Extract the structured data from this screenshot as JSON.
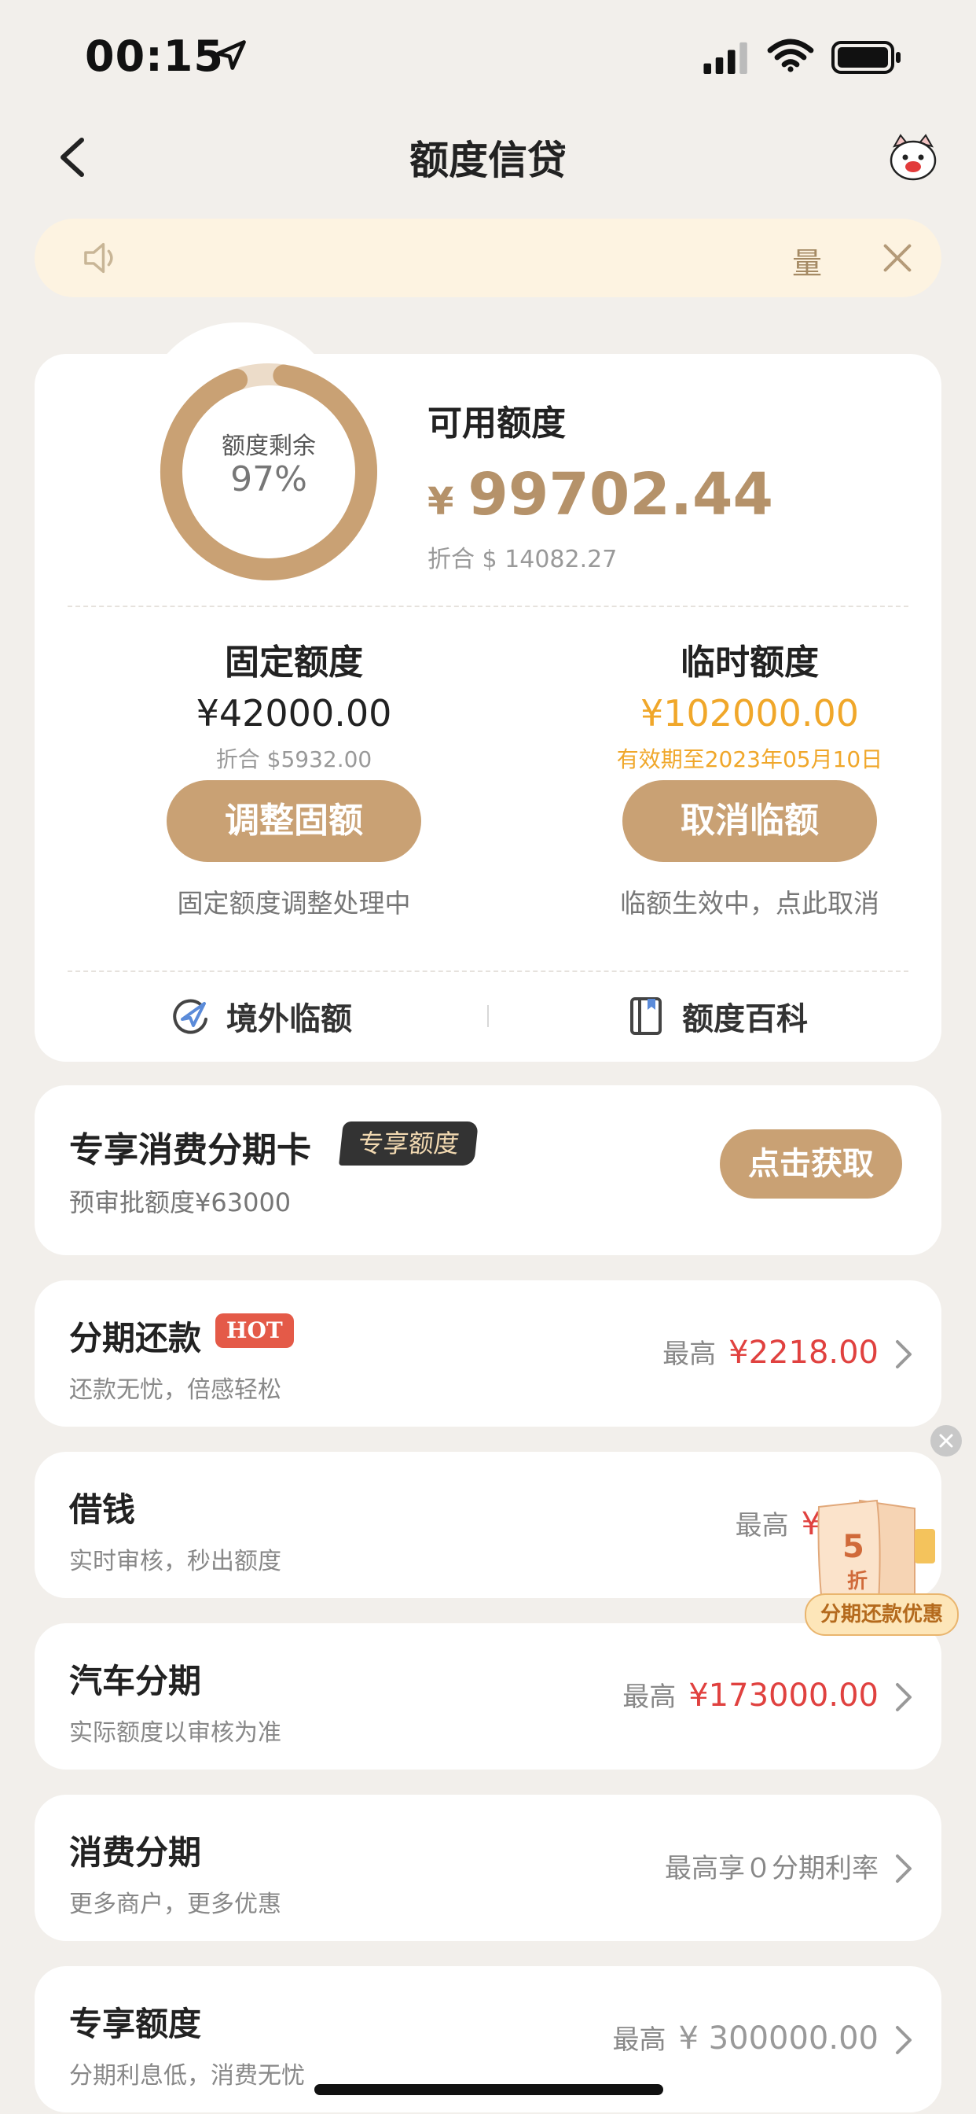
{
  "status_bar": {
    "time": "00:15"
  },
  "nav": {
    "title": "额度信贷"
  },
  "notice": {
    "text": "量"
  },
  "credit": {
    "ring_label": "额度剩余",
    "ring_percent": "97%",
    "ring_fraction": 0.97,
    "available_title": "可用额度",
    "available_currency": "¥",
    "available_amount": "99702.44",
    "available_usd": "折合 $ 14082.27",
    "fixed": {
      "title": "固定额度",
      "amount": "¥42000.00",
      "sub": "折合 $5932.00",
      "button": "调整固额",
      "note": "固定额度调整处理中"
    },
    "temp": {
      "title": "临时额度",
      "amount": "¥102000.00",
      "sub": "有效期至2023年05月10日",
      "button": "取消临额",
      "note": "临额生效中，点此取消"
    },
    "links": {
      "overseas": "境外临额",
      "wiki": "额度百科"
    }
  },
  "exclusive": {
    "title": "专享消费分期卡",
    "badge": "专享额度",
    "sub": "预审批额度¥63000",
    "button": "点击获取"
  },
  "list": [
    {
      "title": "分期还款",
      "tag": "HOT",
      "sub": "还款无忧，倍感轻松",
      "prefix": "最高",
      "amount": "¥2218.00"
    },
    {
      "title": "借钱",
      "sub": "实时审核，秒出额度",
      "prefix": "最高",
      "amount": "¥42"
    },
    {
      "title": "汽车分期",
      "sub": "实际额度以审核为准",
      "prefix": "最高",
      "amount": "¥173000.00"
    },
    {
      "title": "消费分期",
      "sub": "更多商户，更多优惠",
      "text": "最高享０分期利率"
    },
    {
      "title": "专享额度",
      "sub": "分期利息低，消费无忧",
      "prefix": "最高",
      "amount": "¥ 300000.00"
    }
  ],
  "promo": {
    "number": "5",
    "unit": "折",
    "label": "分期还款优惠"
  },
  "colors": {
    "accent": "#c9a174",
    "amount_gold": "#b5926a",
    "orange": "#f0a72a",
    "red": "#e0413f",
    "background": "#f2efeb"
  },
  "icons": [
    "location-arrow-icon",
    "signal-icon",
    "wifi-icon",
    "battery-icon",
    "back-chevron-icon",
    "mascot-icon",
    "speaker-icon",
    "close-icon",
    "airplane-circle-icon",
    "book-icon",
    "chevron-right-icon"
  ]
}
